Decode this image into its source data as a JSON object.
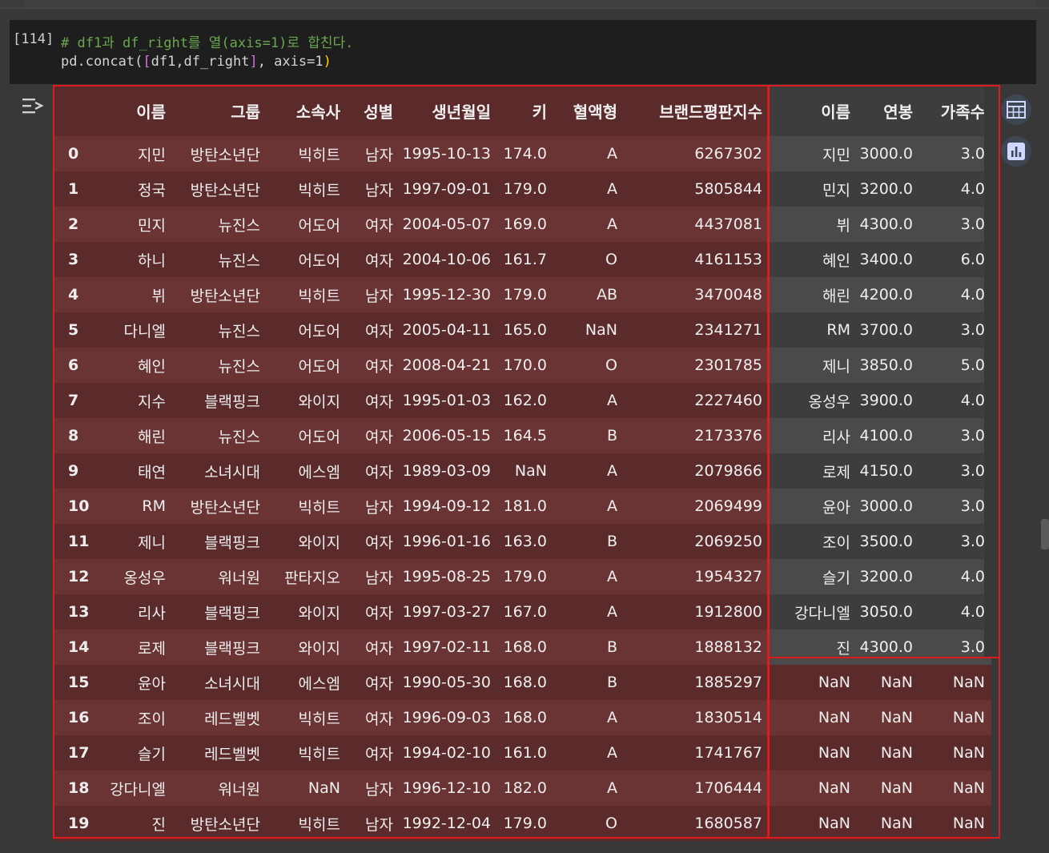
{
  "cell": {
    "exec_count": "[114]",
    "comment": "# df1과 df_right를 열(axis=1)로 합친다.",
    "code_prefix": "pd.concat(",
    "code_open": "[",
    "code_args": "df1,df_right",
    "code_close": "]",
    "code_suffix": ", axis=1",
    "code_end": ")"
  },
  "icons": {
    "output_toggle": "output-collapse-icon",
    "table_view": "table-view-icon",
    "chart_view": "bar-chart-icon"
  },
  "table": {
    "columns": [
      "",
      "이름",
      "그룹",
      "소속사",
      "성별",
      "생년월일",
      "키",
      "혈액형",
      "브랜드평판지수",
      "이름",
      "연봉",
      "가족수"
    ],
    "rows": [
      [
        "0",
        "지민",
        "방탄소년단",
        "빅히트",
        "남자",
        "1995-10-13",
        "174.0",
        "A",
        "6267302",
        "지민",
        "3000.0",
        "3.0"
      ],
      [
        "1",
        "정국",
        "방탄소년단",
        "빅히트",
        "남자",
        "1997-09-01",
        "179.0",
        "A",
        "5805844",
        "민지",
        "3200.0",
        "4.0"
      ],
      [
        "2",
        "민지",
        "뉴진스",
        "어도어",
        "여자",
        "2004-05-07",
        "169.0",
        "A",
        "4437081",
        "뷔",
        "4300.0",
        "3.0"
      ],
      [
        "3",
        "하니",
        "뉴진스",
        "어도어",
        "여자",
        "2004-10-06",
        "161.7",
        "O",
        "4161153",
        "혜인",
        "3400.0",
        "6.0"
      ],
      [
        "4",
        "뷔",
        "방탄소년단",
        "빅히트",
        "남자",
        "1995-12-30",
        "179.0",
        "AB",
        "3470048",
        "해린",
        "4200.0",
        "4.0"
      ],
      [
        "5",
        "다니엘",
        "뉴진스",
        "어도어",
        "여자",
        "2005-04-11",
        "165.0",
        "NaN",
        "2341271",
        "RM",
        "3700.0",
        "3.0"
      ],
      [
        "6",
        "혜인",
        "뉴진스",
        "어도어",
        "여자",
        "2008-04-21",
        "170.0",
        "O",
        "2301785",
        "제니",
        "3850.0",
        "5.0"
      ],
      [
        "7",
        "지수",
        "블랙핑크",
        "와이지",
        "여자",
        "1995-01-03",
        "162.0",
        "A",
        "2227460",
        "옹성우",
        "3900.0",
        "4.0"
      ],
      [
        "8",
        "해린",
        "뉴진스",
        "어도어",
        "여자",
        "2006-05-15",
        "164.5",
        "B",
        "2173376",
        "리사",
        "4100.0",
        "3.0"
      ],
      [
        "9",
        "태연",
        "소녀시대",
        "에스엠",
        "여자",
        "1989-03-09",
        "NaN",
        "A",
        "2079866",
        "로제",
        "4150.0",
        "3.0"
      ],
      [
        "10",
        "RM",
        "방탄소년단",
        "빅히트",
        "남자",
        "1994-09-12",
        "181.0",
        "A",
        "2069499",
        "윤아",
        "3000.0",
        "3.0"
      ],
      [
        "11",
        "제니",
        "블랙핑크",
        "와이지",
        "여자",
        "1996-01-16",
        "163.0",
        "B",
        "2069250",
        "조이",
        "3500.0",
        "3.0"
      ],
      [
        "12",
        "옹성우",
        "워너원",
        "판타지오",
        "남자",
        "1995-08-25",
        "179.0",
        "A",
        "1954327",
        "슬기",
        "3200.0",
        "4.0"
      ],
      [
        "13",
        "리사",
        "블랙핑크",
        "와이지",
        "여자",
        "1997-03-27",
        "167.0",
        "A",
        "1912800",
        "강다니엘",
        "3050.0",
        "4.0"
      ],
      [
        "14",
        "로제",
        "블랙핑크",
        "와이지",
        "여자",
        "1997-02-11",
        "168.0",
        "B",
        "1888132",
        "진",
        "4300.0",
        "3.0"
      ],
      [
        "15",
        "윤아",
        "소녀시대",
        "에스엠",
        "여자",
        "1990-05-30",
        "168.0",
        "B",
        "1885297",
        "NaN",
        "NaN",
        "NaN"
      ],
      [
        "16",
        "조이",
        "레드벨벳",
        "빅히트",
        "여자",
        "1996-09-03",
        "168.0",
        "A",
        "1830514",
        "NaN",
        "NaN",
        "NaN"
      ],
      [
        "17",
        "슬기",
        "레드벨벳",
        "빅히트",
        "여자",
        "1994-02-10",
        "161.0",
        "A",
        "1741767",
        "NaN",
        "NaN",
        "NaN"
      ],
      [
        "18",
        "강다니엘",
        "워너원",
        "NaN",
        "남자",
        "1996-12-10",
        "182.0",
        "A",
        "1706444",
        "NaN",
        "NaN",
        "NaN"
      ],
      [
        "19",
        "진",
        "방탄소년단",
        "빅히트",
        "남자",
        "1992-12-04",
        "179.0",
        "O",
        "1680587",
        "NaN",
        "NaN",
        "NaN"
      ]
    ]
  }
}
